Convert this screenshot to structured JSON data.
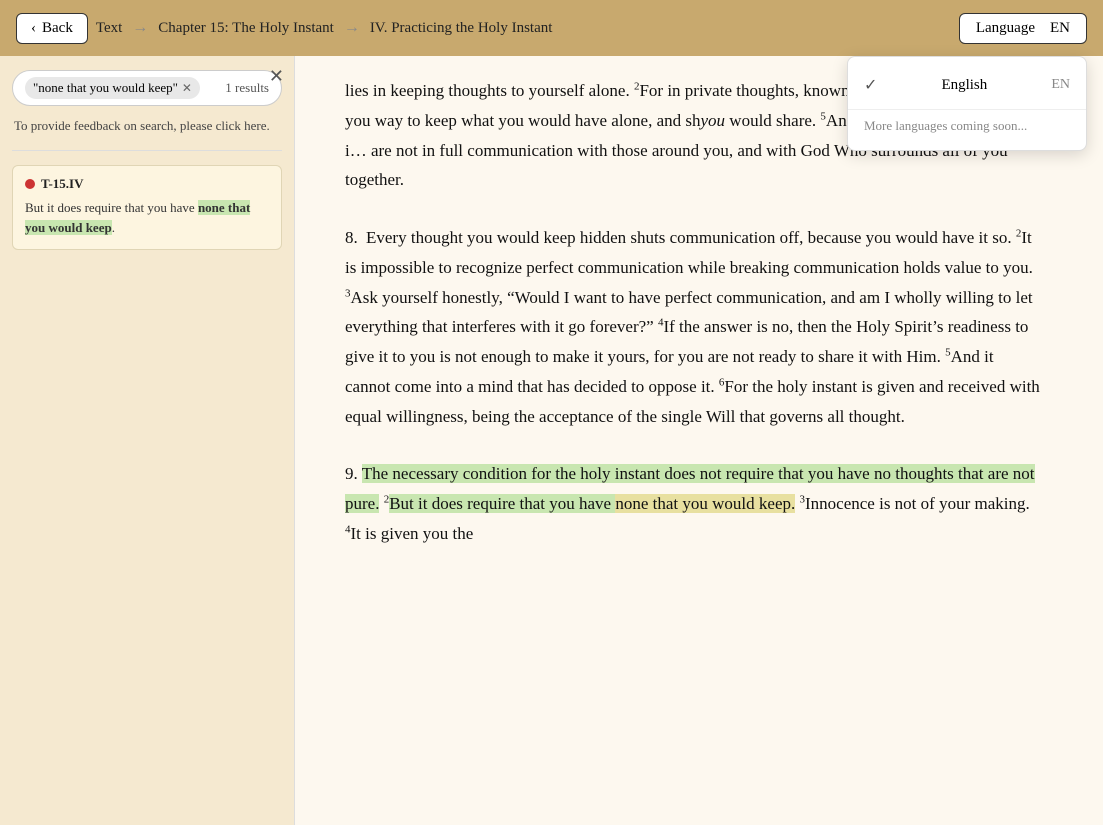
{
  "nav": {
    "back_label": "Back",
    "text_label": "Text",
    "chapter_label": "Chapter 15: The Holy Instant",
    "section_label": "IV. Practicing the Holy Instant",
    "language_label": "Language",
    "language_code": "EN"
  },
  "language_dropdown": {
    "english_label": "English",
    "english_code": "EN",
    "coming_soon": "More languages coming soon..."
  },
  "sidebar": {
    "search_value": "\"none that you would keep\"",
    "results_count": "1 results",
    "feedback_text": "To provide feedback on search, please click here.",
    "result_ref": "T-15.IV",
    "result_snippet_before": "But it does require that you have ",
    "result_snippet_highlight": "none that you would keep",
    "result_snippet_after": "."
  },
  "content": {
    "para7_text": "lies in keeping thoughts to yourself alone. ²For in private thoughts, known only to yourself, you think you way to keep what you would have alone, and sh… you would share. ⁵And then you wonder why it i… are not in full communication with those around you, and with God Who surrounds all of you together.",
    "para8_num": "8.",
    "para8_s1": "Every thought you would keep hidden shuts communication off, because you would have it so.",
    "para8_s2": "It is impossible to recognize perfect communication while breaking communication holds value to you.",
    "para8_s3": "Ask yourself honestly, “Would I want to have perfect communication, and am I wholly willing to let everything that interferes with it go forever?”",
    "para8_s4": "If the answer is no, then the Holy Spirit’s readiness to give it to you is not enough to make it yours, for you are not ready to share it with Him.",
    "para8_s5": "And it cannot come into a mind that has decided to oppose it.",
    "para8_s6": "For the holy instant is given and received with equal willingness, being the acceptance of the single Will that governs all thought.",
    "para9_num": "9.",
    "para9_s1_highlight": "The necessary condition for the holy instant does not require that you have no thoughts that are not pure.",
    "para9_s2_before": "But it does require that you have ",
    "para9_s2_highlight": "none that you would keep.",
    "para9_s3": "Innocence is not of your making.",
    "para9_s4": "It is given you the"
  }
}
